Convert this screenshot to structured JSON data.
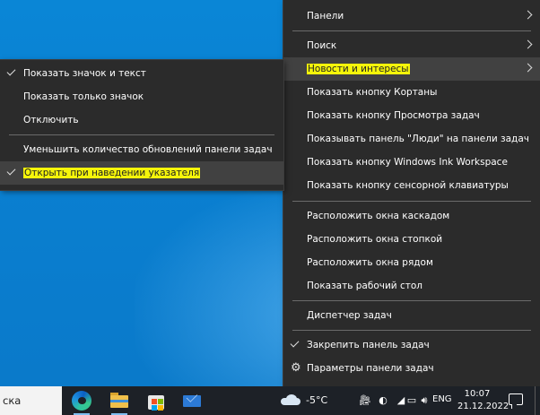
{
  "main_menu": {
    "items": [
      {
        "label": "Панели",
        "submenu": true
      },
      {
        "label": "Поиск",
        "submenu": true
      },
      {
        "label": "Новости и интересы",
        "submenu": true,
        "highlighted": true
      },
      {
        "label": "Показать кнопку Кортаны"
      },
      {
        "label": "Показать кнопку Просмотра задач"
      },
      {
        "label": "Показывать панель \"Люди\" на панели задач"
      },
      {
        "label": "Показать кнопку Windows Ink Workspace"
      },
      {
        "label": "Показать кнопку сенсорной клавиатуры"
      },
      {
        "label": "Расположить окна каскадом"
      },
      {
        "label": "Расположить окна стопкой"
      },
      {
        "label": "Расположить окна рядом"
      },
      {
        "label": "Показать рабочий стол"
      },
      {
        "label": "Диспетчер задач"
      },
      {
        "label": "Закрепить панель задач",
        "checked": true
      },
      {
        "label": "Параметры панели задач",
        "icon": "gear-icon"
      }
    ]
  },
  "sub_menu": {
    "items": [
      {
        "label": "Показать значок и текст",
        "checked": true
      },
      {
        "label": "Показать только значок"
      },
      {
        "label": "Отключить"
      },
      {
        "label": "Уменьшить количество обновлений панели задач"
      },
      {
        "label": "Открыть при наведении указателя",
        "checked": true,
        "highlighted": true
      }
    ]
  },
  "taskbar": {
    "search_text": "ска",
    "apps": [
      "edge-icon",
      "file-explorer-icon",
      "store-icon",
      "mail-icon"
    ],
    "weather": {
      "icon": "cloud-icon",
      "temperature": "-5°C"
    },
    "tray_icons": [
      "meet-now-icon",
      "network-icon",
      "volume-icon",
      "message-icon",
      "speaker-icon"
    ],
    "language": "ENG",
    "time": "10:07",
    "date": "21.12.2022"
  },
  "colors": {
    "menu_bg": "#2b2b2b",
    "highlight_bg": "#414141",
    "marker_yellow": "#f5f50a",
    "taskbar_bg": "#1d2127",
    "desktop_blue": "#0a86d6"
  }
}
